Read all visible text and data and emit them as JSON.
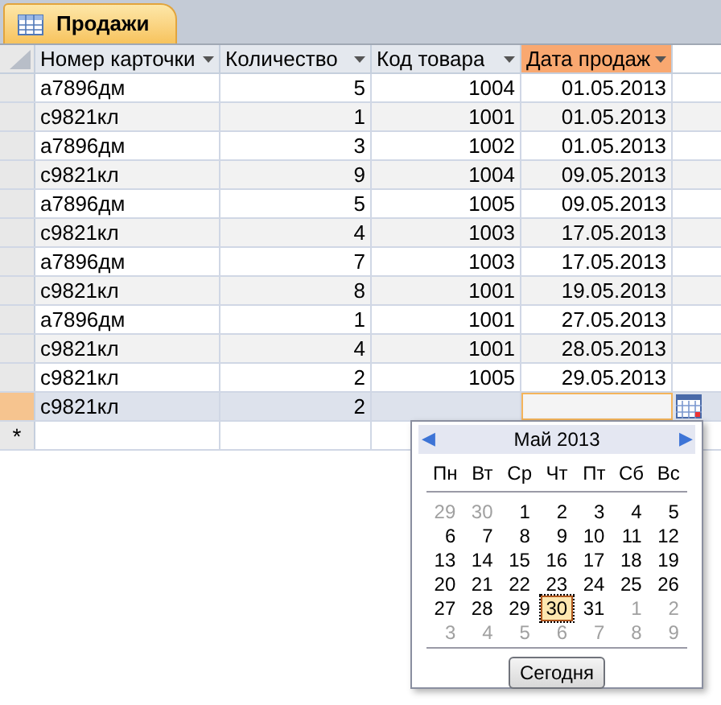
{
  "tab": {
    "title": "Продажи",
    "selected": true
  },
  "columns": [
    {
      "label": "Номер карточки",
      "selected": false
    },
    {
      "label": "Количество",
      "selected": false
    },
    {
      "label": "Код товара",
      "selected": false
    },
    {
      "label": "Дата продаж",
      "selected": true
    }
  ],
  "rows": [
    {
      "card": "а7896дм",
      "qty": "5",
      "code": "1004",
      "date": "01.05.2013",
      "current": false
    },
    {
      "card": "с9821кл",
      "qty": "1",
      "code": "1001",
      "date": "01.05.2013",
      "current": false
    },
    {
      "card": "а7896дм",
      "qty": "3",
      "code": "1002",
      "date": "01.05.2013",
      "current": false
    },
    {
      "card": "с9821кл",
      "qty": "9",
      "code": "1004",
      "date": "09.05.2013",
      "current": false
    },
    {
      "card": "а7896дм",
      "qty": "5",
      "code": "1005",
      "date": "09.05.2013",
      "current": false
    },
    {
      "card": "с9821кл",
      "qty": "4",
      "code": "1003",
      "date": "17.05.2013",
      "current": false
    },
    {
      "card": "а7896дм",
      "qty": "7",
      "code": "1003",
      "date": "17.05.2013",
      "current": false
    },
    {
      "card": "с9821кл",
      "qty": "8",
      "code": "1001",
      "date": "19.05.2013",
      "current": false
    },
    {
      "card": "а7896дм",
      "qty": "1",
      "code": "1001",
      "date": "27.05.2013",
      "current": false
    },
    {
      "card": "с9821кл",
      "qty": "4",
      "code": "1001",
      "date": "28.05.2013",
      "current": false
    },
    {
      "card": "с9821кл",
      "qty": "2",
      "code": "1005",
      "date": "29.05.2013",
      "current": false
    },
    {
      "card": "с9821кл",
      "qty": "2",
      "current": true
    }
  ],
  "new_row_marker": "*",
  "calendar": {
    "prev": "◀",
    "next": "▶",
    "month": "Май 2013",
    "weekdays": [
      "Пн",
      "Вт",
      "Ср",
      "Чт",
      "Пт",
      "Сб",
      "Вс"
    ],
    "weeks": [
      [
        {
          "day": "29",
          "kind": "other",
          "selected": false
        },
        {
          "day": "30",
          "kind": "other",
          "selected": false
        },
        {
          "day": "1",
          "kind": "current",
          "selected": false
        },
        {
          "day": "2",
          "kind": "current",
          "selected": false
        },
        {
          "day": "3",
          "kind": "current",
          "selected": false
        },
        {
          "day": "4",
          "kind": "current",
          "selected": false
        },
        {
          "day": "5",
          "kind": "current",
          "selected": false
        }
      ],
      [
        {
          "day": "6",
          "kind": "current",
          "selected": false
        },
        {
          "day": "7",
          "kind": "current",
          "selected": false
        },
        {
          "day": "8",
          "kind": "current",
          "selected": false
        },
        {
          "day": "9",
          "kind": "current",
          "selected": false
        },
        {
          "day": "10",
          "kind": "current",
          "selected": false
        },
        {
          "day": "11",
          "kind": "current",
          "selected": false
        },
        {
          "day": "12",
          "kind": "current",
          "selected": false
        }
      ],
      [
        {
          "day": "13",
          "kind": "current",
          "selected": false
        },
        {
          "day": "14",
          "kind": "current",
          "selected": false
        },
        {
          "day": "15",
          "kind": "current",
          "selected": false
        },
        {
          "day": "16",
          "kind": "current",
          "selected": false
        },
        {
          "day": "17",
          "kind": "current",
          "selected": false
        },
        {
          "day": "18",
          "kind": "current",
          "selected": false
        },
        {
          "day": "19",
          "kind": "current",
          "selected": false
        }
      ],
      [
        {
          "day": "20",
          "kind": "current",
          "selected": false
        },
        {
          "day": "21",
          "kind": "current",
          "selected": false
        },
        {
          "day": "22",
          "kind": "current",
          "selected": false
        },
        {
          "day": "23",
          "kind": "current",
          "selected": false
        },
        {
          "day": "24",
          "kind": "current",
          "selected": false
        },
        {
          "day": "25",
          "kind": "current",
          "selected": false
        },
        {
          "day": "26",
          "kind": "current",
          "selected": false
        }
      ],
      [
        {
          "day": "27",
          "kind": "current",
          "selected": false
        },
        {
          "day": "28",
          "kind": "current",
          "selected": false
        },
        {
          "day": "29",
          "kind": "current",
          "selected": false
        },
        {
          "day": "30",
          "kind": "current",
          "selected": true
        },
        {
          "day": "31",
          "kind": "current",
          "selected": false
        },
        {
          "day": "1",
          "kind": "other",
          "selected": false
        },
        {
          "day": "2",
          "kind": "other",
          "selected": false
        }
      ],
      [
        {
          "day": "3",
          "kind": "other",
          "selected": false
        },
        {
          "day": "4",
          "kind": "other",
          "selected": false
        },
        {
          "day": "5",
          "kind": "other",
          "selected": false
        },
        {
          "day": "6",
          "kind": "other",
          "selected": false
        },
        {
          "day": "7",
          "kind": "other",
          "selected": false
        },
        {
          "day": "8",
          "kind": "other",
          "selected": false
        },
        {
          "day": "9",
          "kind": "other",
          "selected": false
        }
      ]
    ],
    "today_button": "Сегодня"
  }
}
